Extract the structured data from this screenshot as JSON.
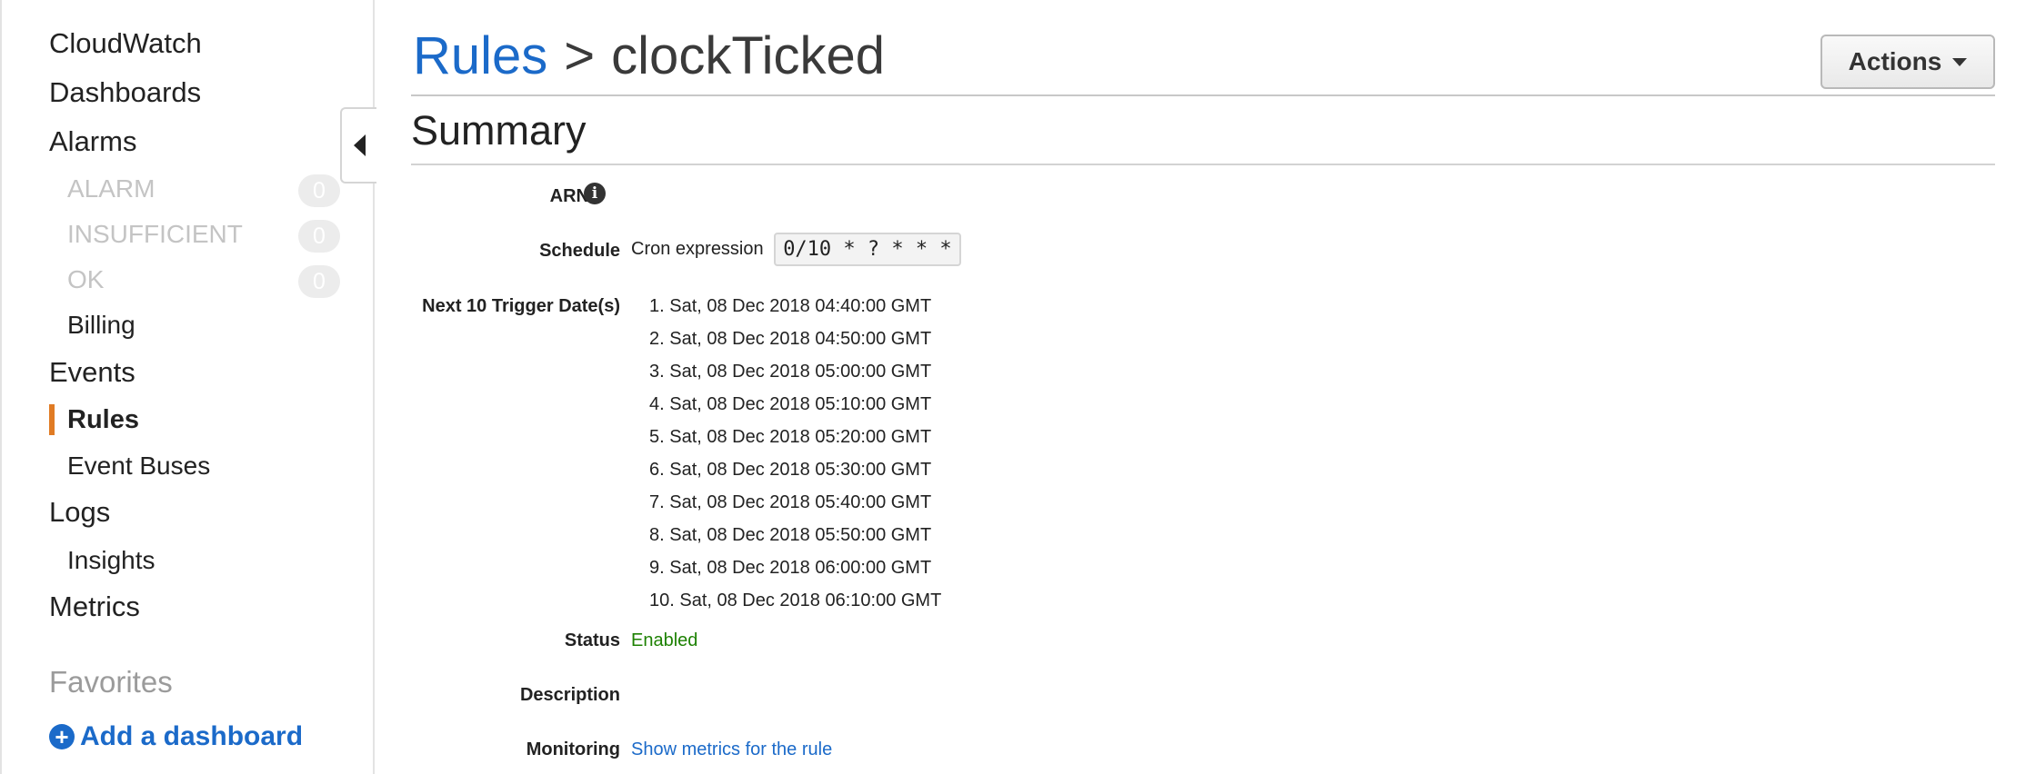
{
  "sidebar": {
    "cloudwatch": "CloudWatch",
    "dashboards": "Dashboards",
    "alarms": "Alarms",
    "alarm_states": [
      {
        "label": "ALARM",
        "count": "0"
      },
      {
        "label": "INSUFFICIENT",
        "count": "0"
      },
      {
        "label": "OK",
        "count": "0"
      }
    ],
    "billing": "Billing",
    "events": "Events",
    "rules": "Rules",
    "event_buses": "Event Buses",
    "logs": "Logs",
    "insights": "Insights",
    "metrics": "Metrics",
    "favorites": "Favorites",
    "add_dashboard": "Add a dashboard"
  },
  "header": {
    "breadcrumb_link": "Rules",
    "separator": ">",
    "current": "clockTicked",
    "actions_label": "Actions"
  },
  "summary": {
    "title": "Summary",
    "arn_label": "ARN",
    "schedule_label": "Schedule",
    "schedule_prefix": "Cron expression",
    "cron_expression": "0/10 * ? * * *",
    "trigger_label": "Next 10 Trigger Date(s)",
    "trigger_dates": [
      "1. Sat, 08 Dec 2018 04:40:00 GMT",
      "2. Sat, 08 Dec 2018 04:50:00 GMT",
      "3. Sat, 08 Dec 2018 05:00:00 GMT",
      "4. Sat, 08 Dec 2018 05:10:00 GMT",
      "5. Sat, 08 Dec 2018 05:20:00 GMT",
      "6. Sat, 08 Dec 2018 05:30:00 GMT",
      "7. Sat, 08 Dec 2018 05:40:00 GMT",
      "8. Sat, 08 Dec 2018 05:50:00 GMT",
      "9. Sat, 08 Dec 2018 06:00:00 GMT",
      "10. Sat, 08 Dec 2018 06:10:00 GMT"
    ],
    "status_label": "Status",
    "status_value": "Enabled",
    "description_label": "Description",
    "monitoring_label": "Monitoring",
    "monitoring_link": "Show metrics for the rule"
  },
  "colors": {
    "accent_link": "#1b6ac9",
    "active_marker": "#e07b24",
    "status_enabled": "#1d8102"
  },
  "icons": {
    "info": "info-icon",
    "collapse": "caret-left-icon",
    "dropdown": "caret-down-icon",
    "add": "plus-circle-icon"
  }
}
